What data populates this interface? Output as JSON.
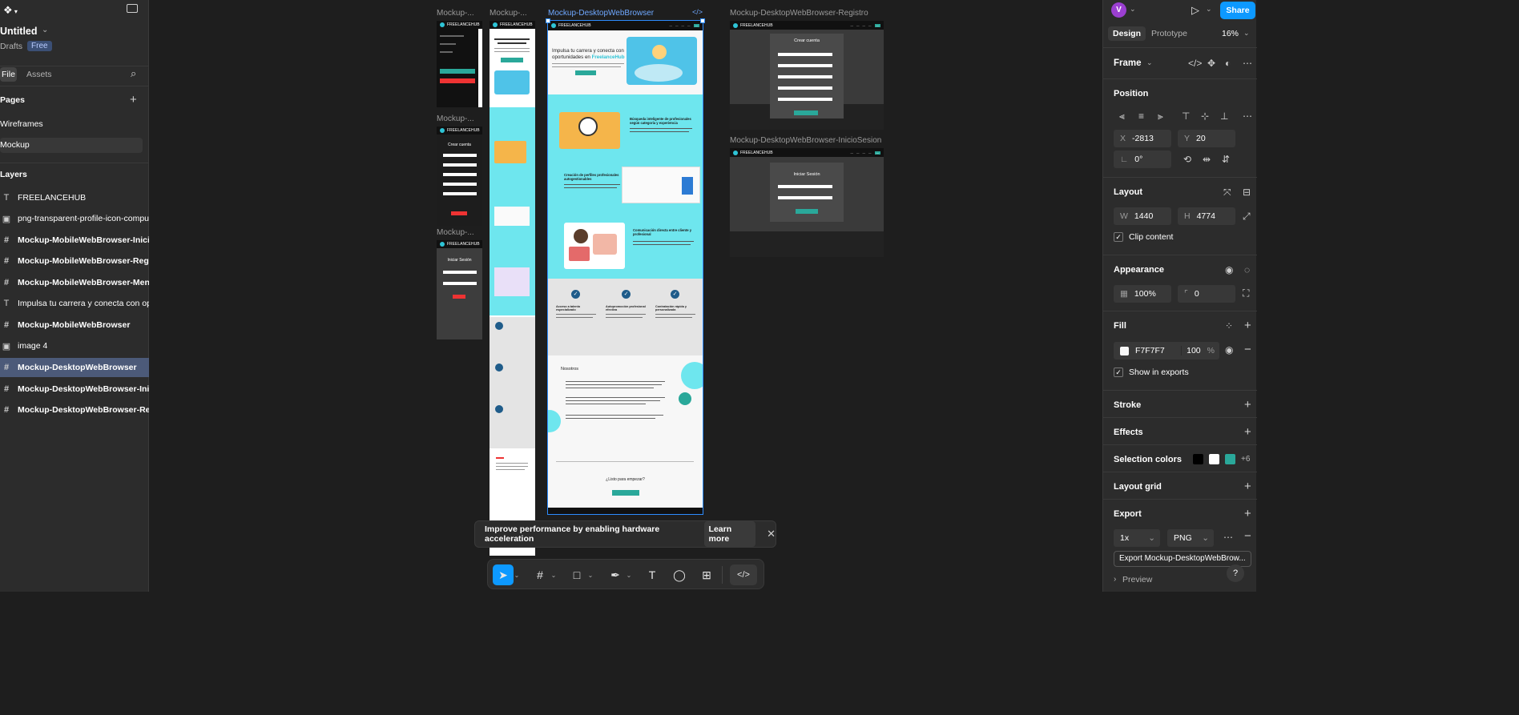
{
  "app": {
    "file_name": "Untitled",
    "location": "Drafts",
    "plan_badge": "Free",
    "tabs": [
      "File",
      "Assets"
    ],
    "pages_title": "Pages",
    "pages": [
      "Wireframes",
      "Mockup"
    ],
    "layers_title": "Layers",
    "layers": [
      {
        "icon": "text-icon",
        "label": "FREELANCEHUB"
      },
      {
        "icon": "image-icon",
        "label": "png-transparent-profile-icon-compute"
      },
      {
        "icon": "frame-icon",
        "label": "Mockup-MobileWebBrowser-InicioSe"
      },
      {
        "icon": "frame-icon",
        "label": "Mockup-MobileWebBrowser-Registro"
      },
      {
        "icon": "frame-icon",
        "label": "Mockup-MobileWebBrowser-Menu"
      },
      {
        "icon": "text-icon",
        "label": "Impulsa tu carrera y conecta con opor"
      },
      {
        "icon": "frame-icon",
        "label": "Mockup-MobileWebBrowser"
      },
      {
        "icon": "image-icon",
        "label": "image 4"
      },
      {
        "icon": "frame-icon",
        "label": "Mockup-DesktopWebBrowser"
      },
      {
        "icon": "frame-icon",
        "label": "Mockup-DesktopWebBrowser-InicioS"
      },
      {
        "icon": "frame-icon",
        "label": "Mockup-DesktopWebBrowser-Regist"
      }
    ]
  },
  "right": {
    "avatar": "V",
    "share": "Share",
    "tabs": [
      "Design",
      "Prototype"
    ],
    "zoom": "16%",
    "frame_label": "Frame",
    "position_title": "Position",
    "x_label": "X",
    "x": "-2813",
    "y_label": "Y",
    "y": "20",
    "rotation": "0°",
    "layout_title": "Layout",
    "w_label": "W",
    "w": "1440",
    "h_label": "H",
    "h": "4774",
    "clip": "Clip content",
    "appearance_title": "Appearance",
    "opacity": "100%",
    "radius": "0",
    "fill_title": "Fill",
    "fill_hex": "F7F7F7",
    "fill_opacity": "100",
    "fill_pct": "%",
    "show_exports": "Show in exports",
    "stroke_title": "Stroke",
    "effects_title": "Effects",
    "selection_colors_title": "Selection colors",
    "selection_colors": [
      "#000000",
      "#ffffff",
      "#2aa89a"
    ],
    "selection_more": "+6",
    "layout_grid_title": "Layout grid",
    "export_title": "Export",
    "export_scale": "1x",
    "export_format": "PNG",
    "export_button": "Export Mockup-DesktopWebBrow...",
    "preview": "Preview"
  },
  "canvas": {
    "labels": {
      "m1": "Mockup-...",
      "m2": "Mockup-...",
      "m3": "Mockup-...",
      "m4": "Mockup-...",
      "desktop": "Mockup-DesktopWebBrowser",
      "registro": "Mockup-DesktopWebBrowser-Registro",
      "inicio": "Mockup-DesktopWebBrowser-InicioSesion"
    },
    "brand": "FREELANCEHUB",
    "hero_title_1": "Impulsa tu carrera y conecta con",
    "hero_title_2": "oportunidades en",
    "hero_brand": "FreelanceHub",
    "sections": {
      "s1": "Búsqueda inteligente de profesionales según categoría y experiencia",
      "s2": "Creación de perfiles profesionales autogestionables",
      "s3": "Comunicación directa entre cliente y profesional",
      "f1": "Acceso a talento especializado",
      "f2": "Autopromoción profesional efectiva",
      "f3": "Contratación rápida y personalizada",
      "about": "Nosotros",
      "cta": "¿Listo para empezar?"
    },
    "create_account": "Crear cuenta",
    "login": "Iniciar Sesión",
    "mobile_create": "Crear cuenta",
    "mobile_login": "Iniciar Sesión"
  },
  "toast": {
    "message": "Improve performance by enabling hardware acceleration",
    "action": "Learn more"
  }
}
